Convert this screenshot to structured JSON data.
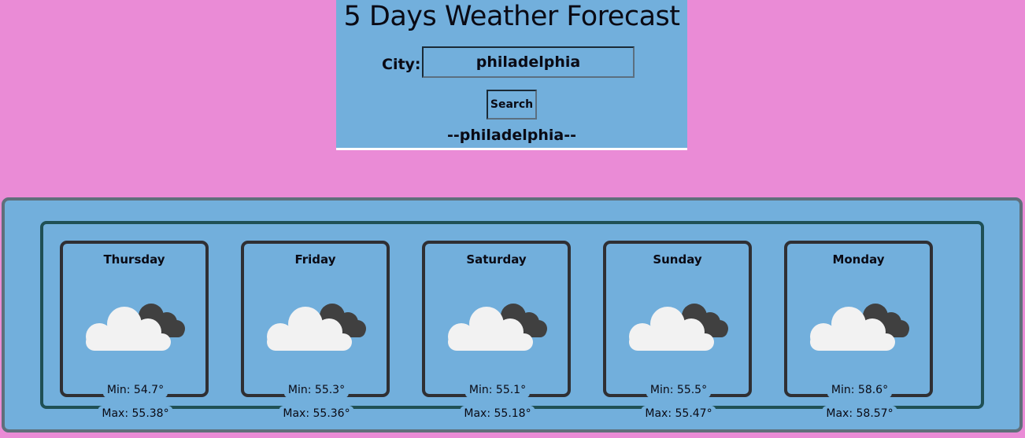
{
  "header": {
    "title": "5 Days Weather Forecast",
    "city_label": "City:",
    "city_value": "philadelphia",
    "search_label": "Search",
    "result_city": "--philadelphia--"
  },
  "forecast": [
    {
      "day": "Thursday",
      "icon": "partly-cloudy-icon",
      "min": "Min: 54.7°",
      "max": "Max: 55.38°"
    },
    {
      "day": "Friday",
      "icon": "partly-cloudy-icon",
      "min": "Min: 55.3°",
      "max": "Max: 55.36°"
    },
    {
      "day": "Saturday",
      "icon": "partly-cloudy-icon",
      "min": "Min: 55.1°",
      "max": "Max: 55.18°"
    },
    {
      "day": "Sunday",
      "icon": "partly-cloudy-icon",
      "min": "Min: 55.5°",
      "max": "Max: 55.47°"
    },
    {
      "day": "Monday",
      "icon": "partly-cloudy-icon",
      "min": "Min: 58.6°",
      "max": "Max: 58.57°"
    }
  ],
  "colors": {
    "background": "#ea8bd6",
    "panel": "#72afdc"
  }
}
